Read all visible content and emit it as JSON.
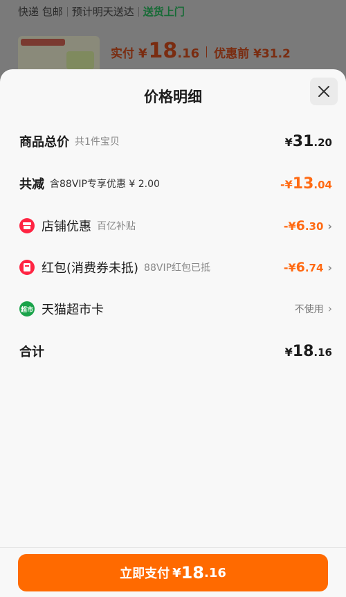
{
  "background": {
    "delivery": {
      "item1": "快递 包邮",
      "item2": "预计明天送达",
      "item3": "送货上门"
    },
    "price": {
      "label": "实付",
      "yen": "¥",
      "int": "18",
      "dec": ".16",
      "before": "优惠前 ¥31.2"
    }
  },
  "sheet": {
    "title": "价格明细",
    "close_icon": "close-icon",
    "rows": {
      "total": {
        "title": "商品总价",
        "sub": "共1件宝贝",
        "sym": "¥",
        "int": "31",
        "dec": ".20"
      },
      "discount": {
        "title": "共减",
        "sub": "含88VIP专享优惠 ¥ 2.00",
        "sym": "-¥",
        "int": "13",
        "dec": ".04"
      },
      "shop": {
        "title": "店铺优惠",
        "sub": "百亿补贴",
        "sym": "-¥",
        "int": "6",
        "dec": ".30",
        "icon": "shop-icon"
      },
      "hongbao": {
        "title": "红包(消费券未抵)",
        "sub": "88VIP红包已抵",
        "sym": "-¥",
        "int": "6",
        "dec": ".74",
        "icon": "red-packet-icon"
      },
      "card": {
        "title": "天猫超市卡",
        "value": "不使用",
        "icon": "tmall-supermarket-icon",
        "icon_text": "超市"
      },
      "sum": {
        "title": "合计",
        "sym": "¥",
        "int": "18",
        "dec": ".16"
      }
    }
  },
  "footer": {
    "pay_label": "立即支付",
    "sym": "¥",
    "int": "18",
    "dec": ".16"
  },
  "colors": {
    "accent": "#ff6a00",
    "discount": "#ff6a13",
    "icon_red": "#ff2442",
    "icon_green": "#1aa34a"
  }
}
